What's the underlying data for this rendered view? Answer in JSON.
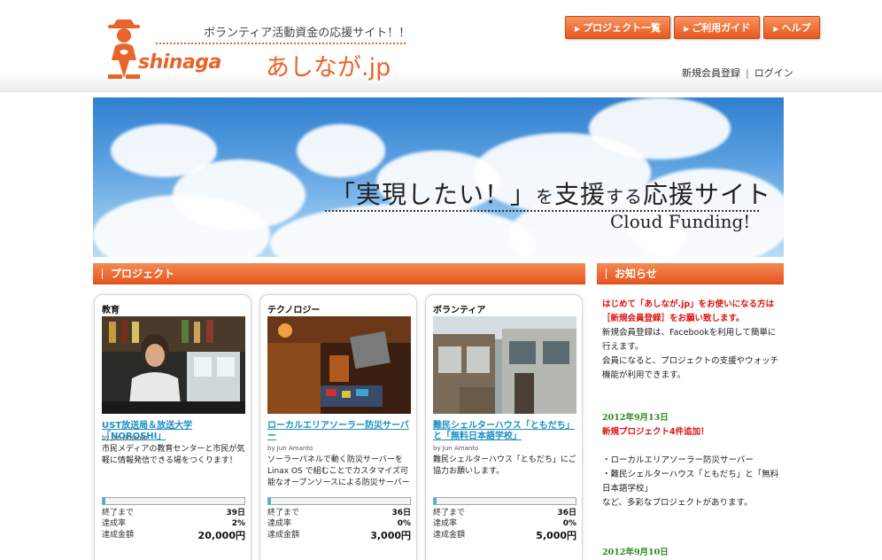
{
  "header": {
    "tagline": "ボランティア活動資金の応援サイト！！",
    "logo_word": "shinaga",
    "logo_jp": "あしなが.jp",
    "nav": [
      {
        "label": "プロジェクト一覧"
      },
      {
        "label": "ご利用ガイド"
      },
      {
        "label": "ヘルプ"
      }
    ],
    "account": {
      "register": "新規会員登録",
      "separator": "|",
      "login": "ログイン"
    }
  },
  "hero": {
    "headline_a": "「実現したい！」",
    "headline_b": "を",
    "headline_c": "支援",
    "headline_d": "する",
    "headline_e": "応援サイト",
    "sub": "Cloud Funding!"
  },
  "sections": {
    "projects": "プロジェクト",
    "news": "お知らせ"
  },
  "projects": [
    {
      "category": "教育",
      "title": "UST放送局＆放送大学「NOROSHI」",
      "by": "by Jun Amanto",
      "desc": "市民メディアの教育センターと市民が気軽に情報発信できる場をつくります！",
      "progress": 2,
      "stats": {
        "end_label": "終了まで",
        "end_value": "39日",
        "rate_label": "達成率",
        "rate_value": "2%",
        "amount_label": "達成金額",
        "amount_value": "20,000円"
      }
    },
    {
      "category": "テクノロジー",
      "title": "ローカルエリアソーラー防災サーバー",
      "by": "by Jun Amanto",
      "desc": "ソーラーパネルで動く防災サーバーをLinax OS で組むことでカスタマイズ可能なオープンソースによる防災サーバー",
      "progress": 0,
      "stats": {
        "end_label": "終了まで",
        "end_value": "36日",
        "rate_label": "達成率",
        "rate_value": "0%",
        "amount_label": "達成金額",
        "amount_value": "3,000円"
      }
    },
    {
      "category": "ボランティア",
      "title": "難民シェルターハウス「ともだち」と「無料日本語学校」",
      "by": "by Jun Amanto",
      "desc": "難民シェルターハウス「ともだち」にご協力お願いします。",
      "progress": 0,
      "stats": {
        "end_label": "終了まで",
        "end_value": "36日",
        "rate_label": "達成率",
        "rate_value": "0%",
        "amount_label": "達成金額",
        "amount_value": "5,000円"
      }
    }
  ],
  "news": {
    "intro_red": "はじめて「あしなが.jp」をお使いになる方は［新規会員登録］をお願い致します。",
    "intro_1": "新規会員登録は、Facebookを利用して簡単に行えます。",
    "intro_2": "会員になると、プロジェクトの支援やウォッチ機能が利用できます。",
    "items": [
      {
        "date": "2012年9月13日",
        "headline": "新規プロジェクト4件追加！",
        "lines": [
          "・ローカルエリアソーラー防災サーバー",
          "・難民シェルターハウス「ともだち」と「無料日本語学校」",
          "など、多彩なプロジェクトがあります。"
        ]
      },
      {
        "date": "2012年9月10日"
      }
    ]
  },
  "colors": {
    "accent": "#e8642a",
    "link": "#1a8fc4",
    "news_date": "#2a8a1a",
    "news_red": "#e01010"
  }
}
